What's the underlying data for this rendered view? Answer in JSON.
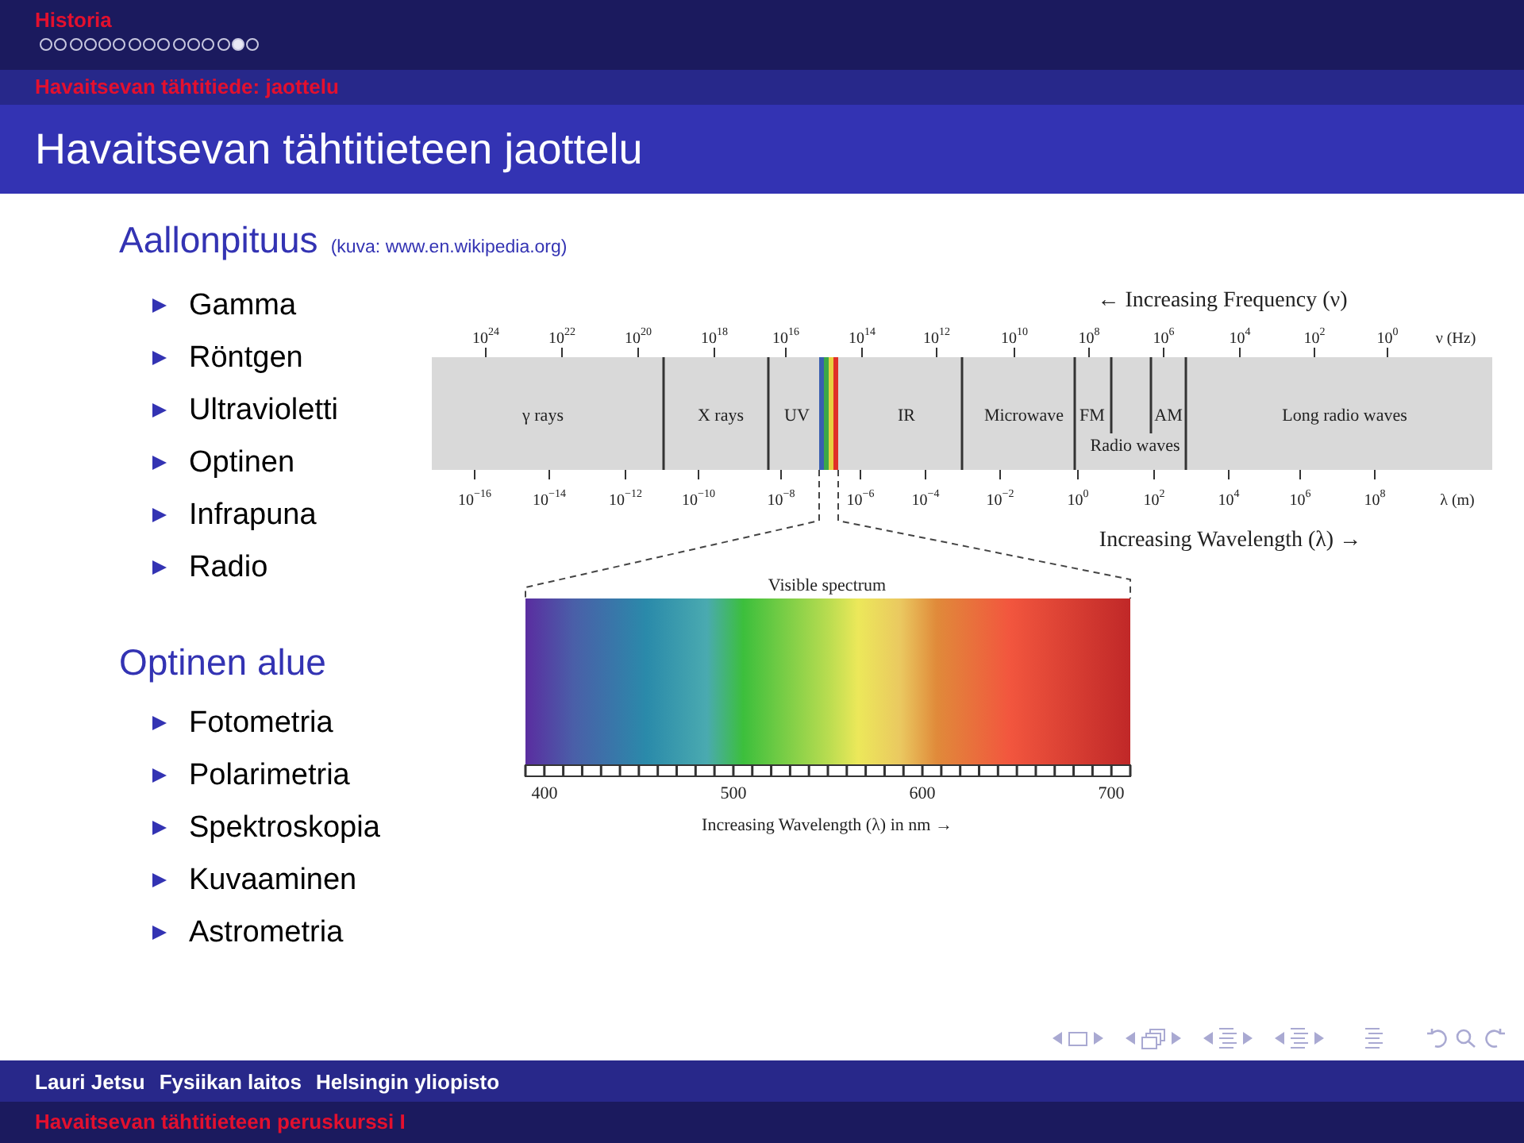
{
  "header": {
    "section": "Historia",
    "slides": [
      {
        "selected": false
      },
      {
        "selected": false
      },
      {
        "selected": false
      },
      {
        "selected": false
      },
      {
        "selected": false
      },
      {
        "selected": false
      },
      {
        "selected": false
      },
      {
        "selected": false
      },
      {
        "selected": false
      },
      {
        "selected": false
      },
      {
        "selected": false
      },
      {
        "selected": false
      },
      {
        "selected": false
      },
      {
        "selected": true
      },
      {
        "selected": false
      }
    ],
    "subsection": "Havaitsevan tähtitiede: jaottelu"
  },
  "frame_title": "Havaitsevan tähtitieteen jaottelu",
  "blocks": [
    {
      "heading": "Aallonpituus",
      "caption": "(kuva: www.en.wikipedia.org)",
      "items": [
        "Gamma",
        "Röntgen",
        "Ultravioletti",
        "Optinen",
        "Infrapuna",
        "Radio"
      ]
    },
    {
      "heading": "Optinen alue",
      "items": [
        "Fotometria",
        "Polarimetria",
        "Spektroskopia",
        "Kuvaaminen",
        "Astrometria"
      ]
    }
  ],
  "figure": {
    "frequency_title": "← Increasing Frequency (ν)",
    "frequency_ticks": [
      {
        "base": "10",
        "exp": "24"
      },
      {
        "base": "10",
        "exp": "22"
      },
      {
        "base": "10",
        "exp": "20"
      },
      {
        "base": "10",
        "exp": "18"
      },
      {
        "base": "10",
        "exp": "16"
      },
      {
        "base": "10",
        "exp": "14"
      },
      {
        "base": "10",
        "exp": "12"
      },
      {
        "base": "10",
        "exp": "10"
      },
      {
        "base": "10",
        "exp": "8"
      },
      {
        "base": "10",
        "exp": "6"
      },
      {
        "base": "10",
        "exp": "4"
      },
      {
        "base": "10",
        "exp": "2"
      },
      {
        "base": "10",
        "exp": "0"
      }
    ],
    "frequency_unit": "ν (Hz)",
    "bands": [
      "γ rays",
      "X rays",
      "UV",
      "IR",
      "Microwave",
      "FM",
      "AM",
      "Long radio waves"
    ],
    "band_group": "Radio waves",
    "wavelength_ticks": [
      {
        "base": "10",
        "exp": "−16"
      },
      {
        "base": "10",
        "exp": "−14"
      },
      {
        "base": "10",
        "exp": "−12"
      },
      {
        "base": "10",
        "exp": "−10"
      },
      {
        "base": "10",
        "exp": "−8"
      },
      {
        "base": "10",
        "exp": "−6"
      },
      {
        "base": "10",
        "exp": "−4"
      },
      {
        "base": "10",
        "exp": "−2"
      },
      {
        "base": "10",
        "exp": "0"
      },
      {
        "base": "10",
        "exp": "2"
      },
      {
        "base": "10",
        "exp": "4"
      },
      {
        "base": "10",
        "exp": "6"
      },
      {
        "base": "10",
        "exp": "8"
      }
    ],
    "wavelength_unit": "λ (m)",
    "wavelength_title": "Increasing Wavelength (λ) →",
    "visible_title": "Visible spectrum",
    "visible_ticks": [
      "400",
      "500",
      "600",
      "700"
    ],
    "visible_axis": "Increasing Wavelength (λ) in nm →"
  },
  "footer": {
    "authors": [
      "Lauri Jetsu",
      "Fysiikan laitos",
      "Helsingin yliopisto"
    ],
    "title": "Havaitsevan tähtitieteen peruskurssi I"
  }
}
